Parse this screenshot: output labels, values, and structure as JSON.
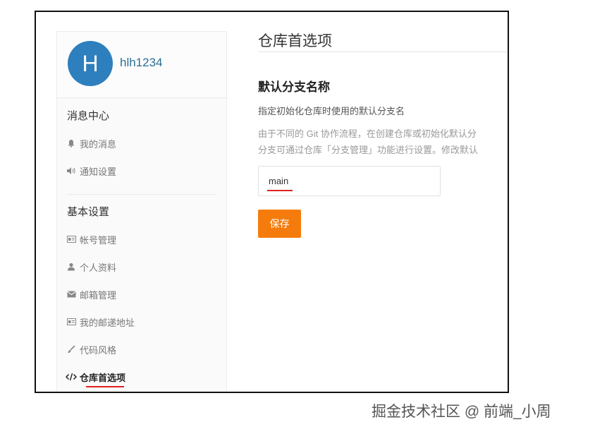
{
  "profile": {
    "avatar_letter": "H",
    "username": "hlh1234"
  },
  "sidebar": {
    "groups": [
      {
        "title": "消息中心",
        "items": [
          {
            "label": "我的消息",
            "icon": "bell-icon"
          },
          {
            "label": "通知设置",
            "icon": "speaker-icon"
          }
        ]
      },
      {
        "title": "基本设置",
        "items": [
          {
            "label": "帐号管理",
            "icon": "id-card-icon"
          },
          {
            "label": "个人资料",
            "icon": "user-icon"
          },
          {
            "label": "邮箱管理",
            "icon": "envelope-icon"
          },
          {
            "label": "我的邮递地址",
            "icon": "id-card-icon"
          },
          {
            "label": "代码风格",
            "icon": "brush-icon"
          },
          {
            "label": "仓库首选项",
            "icon": "code-icon",
            "active": true
          }
        ]
      }
    ]
  },
  "main": {
    "page_title": "仓库首选项",
    "section_title": "默认分支名称",
    "desc_line1": "指定初始化仓库时使用的默认分支名",
    "desc_line2": "由于不同的 Git 协作流程，在创建仓库或初始化默认分",
    "desc_line3": "分支可通过仓库「分支管理」功能进行设置。修改默认",
    "branch_value": "main",
    "save_label": "保存"
  },
  "watermark": "掘金技术社区 @ 前端_小周",
  "colors": {
    "accent": "#f57c0c",
    "avatar": "#2e7fbd",
    "underline": "#dd2222"
  }
}
